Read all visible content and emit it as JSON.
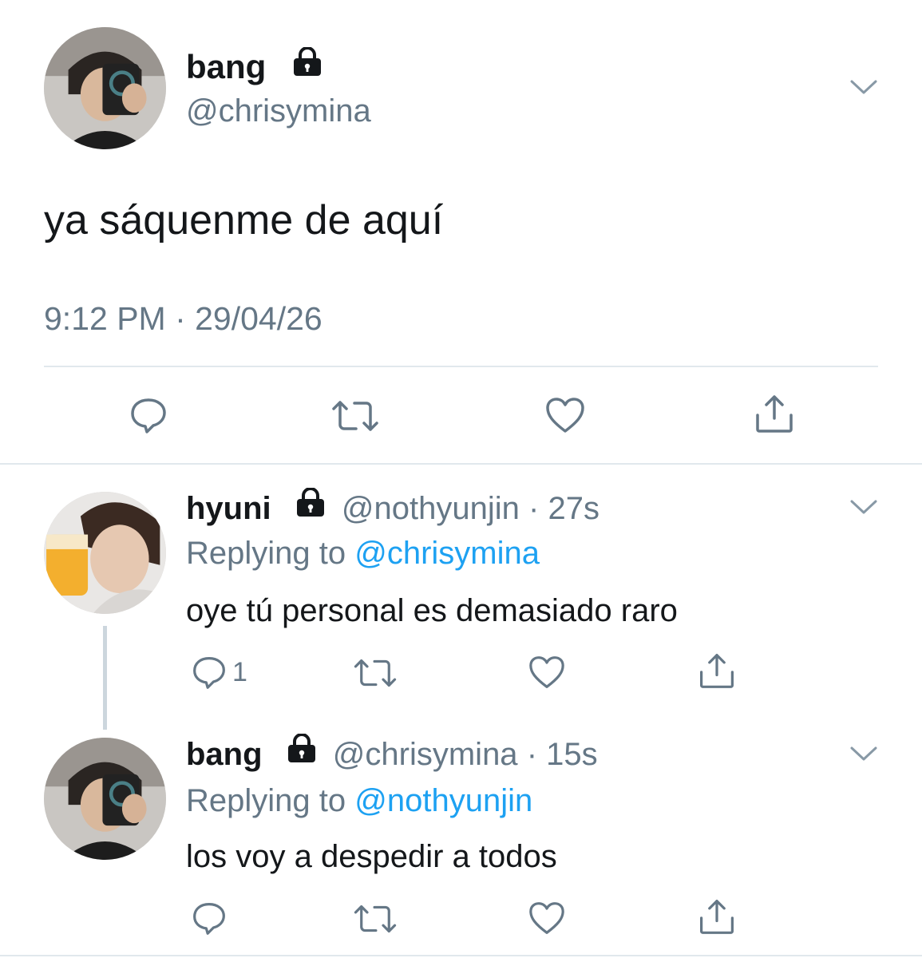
{
  "main_tweet": {
    "display_name": "bang",
    "handle": "@chrisymina",
    "text": "ya sáquenme de aquí",
    "timestamp": "9:12 PM · 29/04/26",
    "protected_icon": "lock-icon",
    "menu_icon": "chevron-down-icon",
    "actions": [
      "reply-icon",
      "retweet-icon",
      "like-icon",
      "share-icon"
    ]
  },
  "replies": [
    {
      "display_name": "hyuni",
      "handle": "@nothyunjin",
      "sep": "·",
      "time": "27s",
      "replying_prefix": "Replying to",
      "replying_to": "@chrisymina",
      "text": "oye tú personal es demasiado raro",
      "reply_count": "1"
    },
    {
      "display_name": "bang",
      "handle": "@chrisymina",
      "sep": "·",
      "time": "15s",
      "replying_prefix": "Replying to",
      "replying_to": "@nothyunjin",
      "text": "los voy a despedir a todos",
      "reply_count": ""
    }
  ],
  "colors": {
    "text": "#14171a",
    "muted": "#657786",
    "link": "#1da1f2",
    "icon": "#657786",
    "divider": "#e1e8ed"
  }
}
